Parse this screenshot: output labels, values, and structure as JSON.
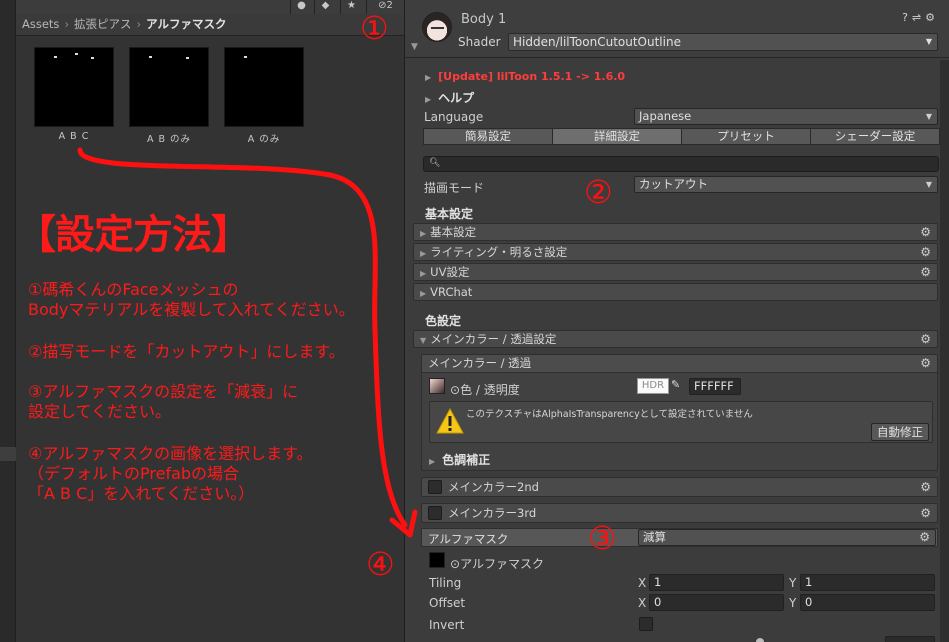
{
  "project": {
    "breadcrumb": [
      "Assets",
      "拡張ピアス",
      "アルファマスク"
    ],
    "toolbar_badge": "2",
    "assets": [
      {
        "name": "A B C"
      },
      {
        "name": "A B のみ"
      },
      {
        "name": "A のみ"
      }
    ]
  },
  "instructions": {
    "title": "【設定方法】",
    "lines": [
      "①碼希くんのFaceメッシュの",
      "Bodyマテリアルを複製して入れてください。",
      "②描写モードを「カットアウト」にします。",
      "③アルファマスクの設定を「減衰」に",
      "設定してください。",
      "④アルファマスクの画像を選択します。",
      "（デフォルトのPrefabの場合",
      "「A B C」を入れてください。）"
    ],
    "color": "#ff1a1a"
  },
  "annotations": {
    "n1": "①",
    "n2": "②",
    "n3": "③",
    "n4": "④"
  },
  "inspector": {
    "material_name": "Body 1",
    "shader_label": "Shader",
    "shader_value": "Hidden/lilToonCutoutOutline",
    "update_notice": "[Update] lilToon 1.5.1 -> 1.6.0",
    "help_label": "ヘルプ",
    "language_label": "Language",
    "language_value": "Japanese",
    "tabs": [
      "簡易設定",
      "詳細設定",
      "プリセット",
      "シェーダー設定"
    ],
    "render_mode_label": "描画モード",
    "render_mode_value": "カットアウト",
    "basic_section_title": "基本設定",
    "basic_folds": [
      "基本設定",
      "ライティング・明るさ設定",
      "UV設定",
      "VRChat"
    ],
    "color_section_title": "色設定",
    "main_color_fold": "メインカラー / 透過設定",
    "main_color_box": {
      "title": "メインカラー / 透過",
      "color_label": "色 / 透明度",
      "hdr_label": "HDR",
      "hex_value": "FFFFFF",
      "warning": "このテクスチャはAlphaIsTransparencyとして設定されていません",
      "fix_button": "自動修正",
      "tone_correction": "色調補正"
    },
    "main_color_2nd": "メインカラー2nd",
    "main_color_3rd": "メインカラー3rd",
    "alpha_mask": {
      "label": "アルファマスク",
      "mode_value": "減算",
      "texture_label": "アルファマスク",
      "tiling_label": "Tiling",
      "offset_label": "Offset",
      "x_label": "X",
      "y_label": "Y",
      "tiling_x": "1",
      "tiling_y": "1",
      "offset_x": "0",
      "offset_y": "0",
      "invert_label": "Invert"
    }
  }
}
